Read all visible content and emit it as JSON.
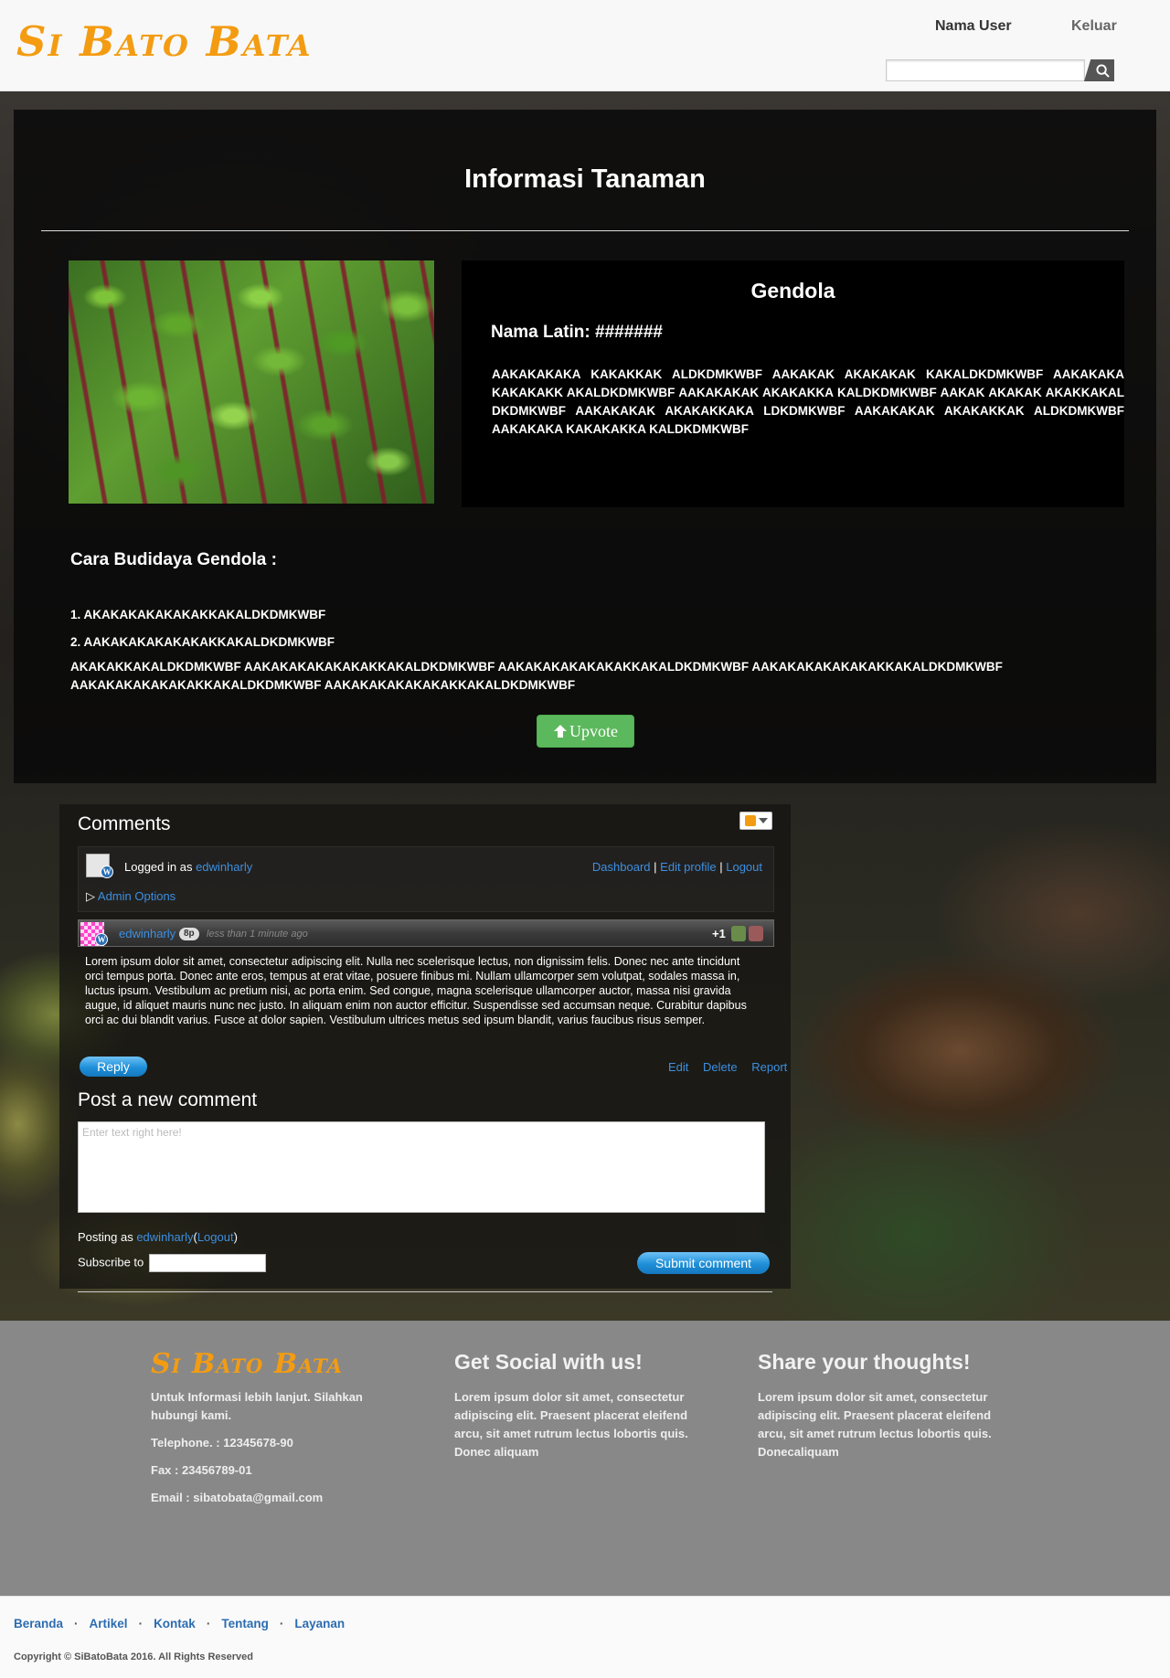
{
  "header": {
    "logo": "Si Bato Bata",
    "user_name": "Nama User",
    "logout_label": "Keluar",
    "search_placeholder": "",
    "search_icon": "magnifier-icon"
  },
  "plant": {
    "page_title": "Informasi Tanaman",
    "name": "Gendola",
    "latin_name": "Nama Latin: #######",
    "description": "AAKAKAKAKA KAKAKKAK ALDKDMKWBF AAKAKAK AKAKAKAK KAKALDKDMKWBF AAKAKAKA KAKAKAKK AKALDKDMKWBF AAKAKAKAK AKAKAKKA KALDKDMKWBF AAKAK AKAKAK AKAKKAKAL DKDMKWBF AAKAKAKAK AKAKAKKAKA LDKDMKWBF AAKAKAKAK AKAKAKKAK ALDKDMKWBF AAKAKAKA KAKAKAKKA KALDKDMKWBF",
    "image_alt": "Gendola plant",
    "cultivation_title": "Cara Budidaya Gendola :",
    "steps": [
      "1. AKAKAKAKAKAKAKKAKALDKDMKWBF",
      "2. AAKAKAKAKAKAKAKKAKALDKDMKWBF"
    ],
    "extra_text": "AKAKAKKAKALDKDMKWBF AAKAKAKAKAKAKAKKAKALDKDMKWBF AAKAKAKAKAKAKAKKAKALDKDMKWBF AAKAKAKAKAKAKAKKAKALDKDMKWBF AAKAKAKAKAKAKAKKAKALDKDMKWBF AAKAKAKAKAKAKAKKAKALDKDMKWBF",
    "upvote_label": "Upvote",
    "upvote_icon": "arrow-up-icon"
  },
  "comments": {
    "title": "Comments",
    "logged_in_prefix": "Logged in as",
    "username": "edwinharly",
    "dashboard_label": "Dashboard",
    "edit_profile_label": "Edit profile",
    "logout_label": "Logout",
    "separator": "|",
    "admin_options_label": "Admin Options",
    "comment": {
      "author": "edwinharly",
      "badge": "8p",
      "time": "less than 1 minute ago",
      "score": "+1",
      "body": "Lorem ipsum dolor sit amet, consectetur adipiscing elit. Nulla nec scelerisque lectus, non dignissim felis. Donec nec ante tincidunt orci tempus porta. Donec ante eros, tempus at erat vitae, posuere finibus mi. Nullam ullamcorper sem volutpat, sodales massa in, luctus ipsum. Vestibulum ac pretium nisi, ac porta enim. Sed congue, magna scelerisque ullamcorper auctor, massa nisi gravida augue, id aliquet mauris nunc nec justo. In aliquam enim non auctor efficitur. Suspendisse sed accumsan neque. Curabitur dapibus orci ac dui blandit varius. Fusce at dolor sapien. Vestibulum ultrices metus sed ipsum blandit, varius faucibus risus semper.",
      "reply_label": "Reply",
      "edit_label": "Edit",
      "delete_label": "Delete",
      "report_label": "Report"
    },
    "post_title": "Post a new comment",
    "textarea_placeholder": "Enter text right here!",
    "posting_as_prefix": "Posting as",
    "posting_user": "edwinharly",
    "posting_logout": "Logout",
    "subscribe_label": "Subscribe to",
    "submit_label": "Submit comment"
  },
  "footer": {
    "logo": "Si Bato Bata",
    "info": "Untuk Informasi lebih lanjut. Silahkan hubungi kami.",
    "telephone": "Telephone. : 12345678-90",
    "fax": "Fax : 23456789-01",
    "email": "Email : sibatobata@gmail.com",
    "social_title": "Get Social with us!",
    "social_text": "Lorem ipsum dolor sit amet, consectetur adipiscing elit. Praesent placerat eleifend arcu, sit amet rutrum lectus lobortis quis. Donec aliquam",
    "share_title": "Share your thoughts!",
    "share_text": "Lorem ipsum dolor sit amet, consectetur adipiscing elit. Praesent placerat eleifend arcu, sit amet rutrum lectus lobortis quis. Donecaliquam",
    "nav": [
      "Beranda",
      "Artikel",
      "Kontak",
      "Tentang",
      "Layanan"
    ],
    "nav_separator": "·",
    "copyright": "Copyright © SiBatoBata 2016. All Rights Reserved"
  },
  "colors": {
    "brand": "#f39c12",
    "upvote": "#5cb85c",
    "link": "#3d8fe0",
    "footer_bg": "#888888"
  }
}
